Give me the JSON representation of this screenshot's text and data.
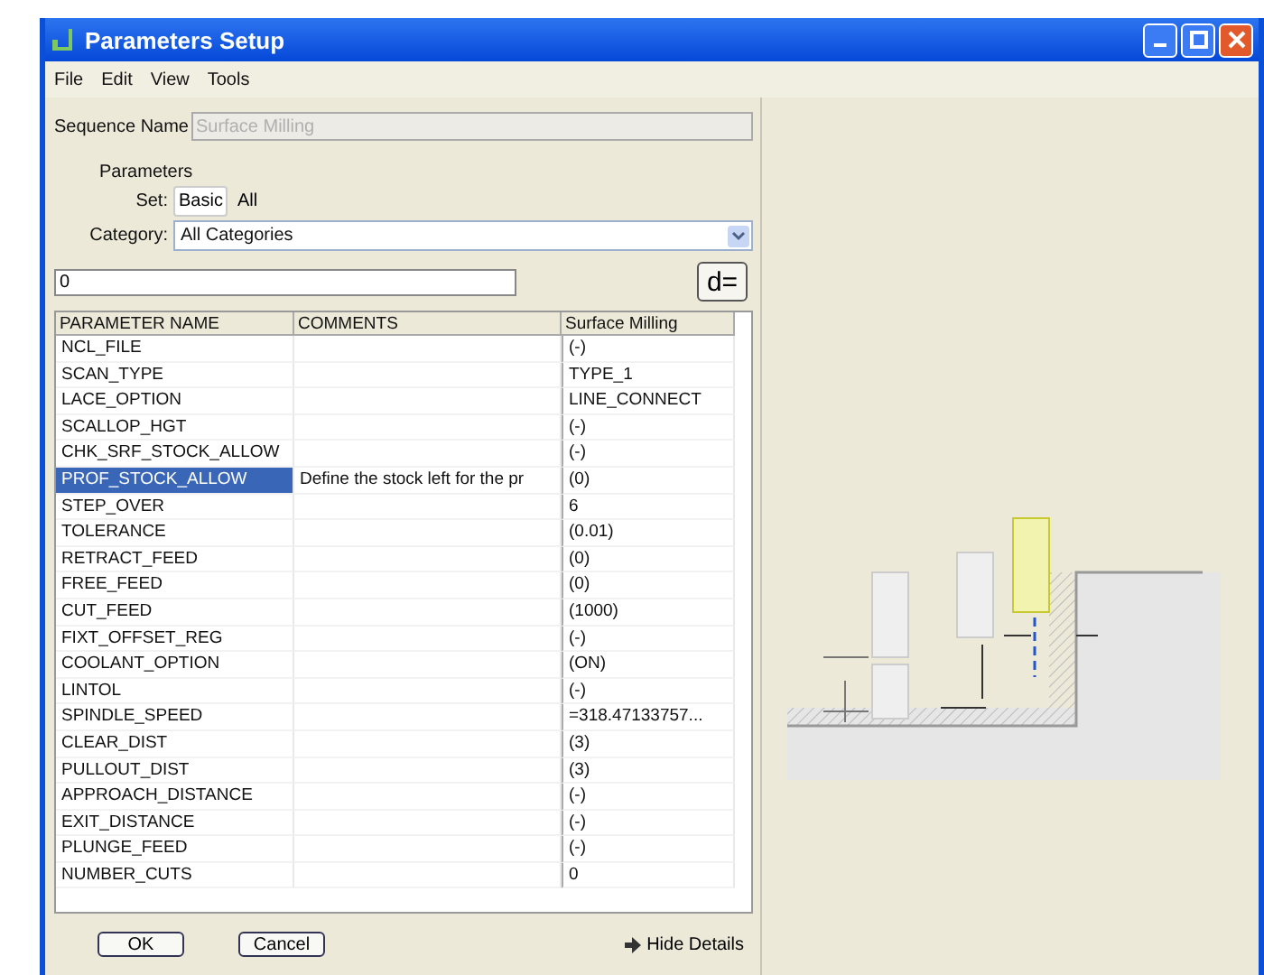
{
  "window": {
    "title": "Parameters Setup"
  },
  "menu": [
    "File",
    "Edit",
    "View",
    "Tools"
  ],
  "sequence_name": {
    "label": "Sequence Name",
    "value": "Surface Milling",
    "disabled": true
  },
  "parameters_label": "Parameters",
  "set": {
    "label": "Set:",
    "options": [
      {
        "label": "Basic",
        "selected": true
      },
      {
        "label": "All",
        "selected": false
      }
    ]
  },
  "category": {
    "label": "Category:",
    "value": "All Categories"
  },
  "filter": {
    "value": "0"
  },
  "formula_button": "d=",
  "table": {
    "columns": [
      "PARAMETER NAME",
      "COMMENTS",
      "Surface Milling"
    ],
    "rows": [
      {
        "name": "NCL_FILE",
        "comment": "",
        "value": "(-)",
        "selected": false
      },
      {
        "name": "SCAN_TYPE",
        "comment": "",
        "value": "TYPE_1",
        "selected": false
      },
      {
        "name": "LACE_OPTION",
        "comment": "",
        "value": "LINE_CONNECT",
        "selected": false
      },
      {
        "name": "SCALLOP_HGT",
        "comment": "",
        "value": "(-)",
        "selected": false
      },
      {
        "name": "CHK_SRF_STOCK_ALLOW",
        "comment": "",
        "value": "(-)",
        "selected": false
      },
      {
        "name": "PROF_STOCK_ALLOW",
        "comment": "Define the stock left for the pr",
        "value": "(0)",
        "selected": true
      },
      {
        "name": "STEP_OVER",
        "comment": "",
        "value": "6",
        "selected": false
      },
      {
        "name": "TOLERANCE",
        "comment": "",
        "value": "(0.01)",
        "selected": false
      },
      {
        "name": "RETRACT_FEED",
        "comment": "",
        "value": "(0)",
        "selected": false
      },
      {
        "name": "FREE_FEED",
        "comment": "",
        "value": "(0)",
        "selected": false
      },
      {
        "name": "CUT_FEED",
        "comment": "",
        "value": "(1000)",
        "selected": false
      },
      {
        "name": "FIXT_OFFSET_REG",
        "comment": "",
        "value": "(-)",
        "selected": false
      },
      {
        "name": "COOLANT_OPTION",
        "comment": "",
        "value": "(ON)",
        "selected": false
      },
      {
        "name": "LINTOL",
        "comment": "",
        "value": "(-)",
        "selected": false
      },
      {
        "name": "SPINDLE_SPEED",
        "comment": "",
        "value": "=318.47133757...",
        "selected": false
      },
      {
        "name": "CLEAR_DIST",
        "comment": "",
        "value": "(3)",
        "selected": false
      },
      {
        "name": "PULLOUT_DIST",
        "comment": "",
        "value": "(3)",
        "selected": false
      },
      {
        "name": "APPROACH_DISTANCE",
        "comment": "",
        "value": "(-)",
        "selected": false
      },
      {
        "name": "EXIT_DISTANCE",
        "comment": "",
        "value": "(-)",
        "selected": false
      },
      {
        "name": "PLUNGE_FEED",
        "comment": "",
        "value": "(-)",
        "selected": false
      },
      {
        "name": "NUMBER_CUTS",
        "comment": "",
        "value": "0",
        "selected": false
      }
    ]
  },
  "buttons": [
    "OK",
    "Cancel"
  ],
  "details_toggle": "Hide Details"
}
